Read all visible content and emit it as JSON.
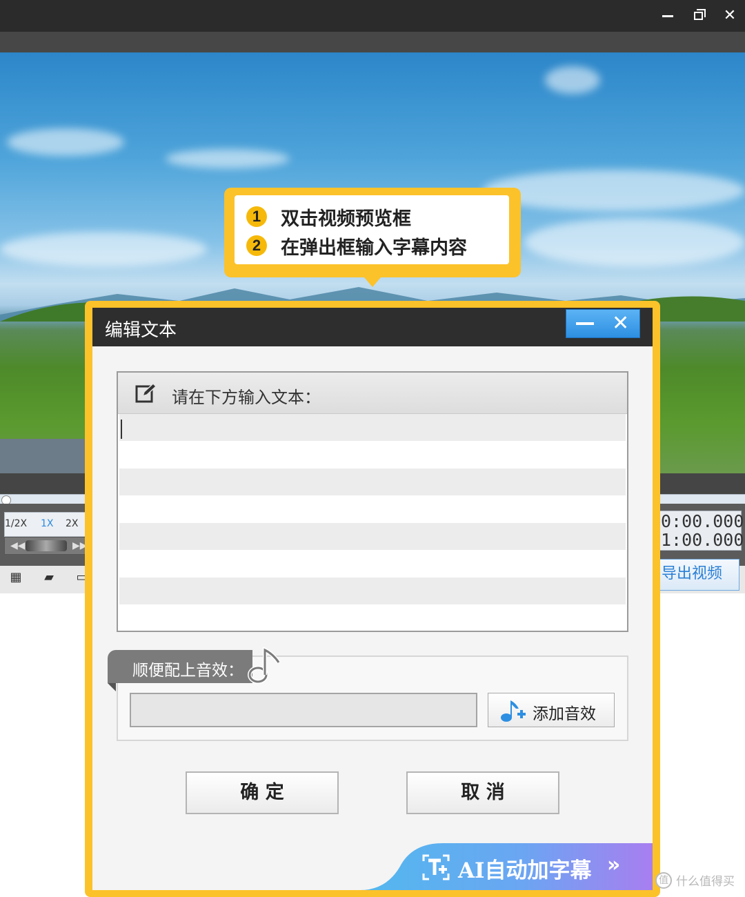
{
  "app": {
    "window_controls": {
      "minimize": "minimize",
      "restore": "restore",
      "close": "close"
    }
  },
  "player": {
    "speeds": [
      "1/2X",
      "1X",
      "2X"
    ],
    "active_speed": "1X",
    "time_current": "0:00.000",
    "time_total": "1:00.000",
    "export_label": "导出视频"
  },
  "callout": {
    "steps": [
      {
        "num": "1",
        "text": "双击视频预览框"
      },
      {
        "num": "2",
        "text": "在弹出框输入字幕内容"
      }
    ]
  },
  "dialog": {
    "title": "编辑文本",
    "input_label": "请在下方输入文本：",
    "sound_label": "顺便配上音效：",
    "add_sound_label": "添加音效",
    "ok_label": "确 定",
    "cancel_label": "取 消",
    "ai_label": "AI自动加字幕"
  },
  "watermark": {
    "badge": "值",
    "text": "什么值得买"
  },
  "colors": {
    "accent_yellow": "#fcc22a",
    "title_dark": "#2e2e2e",
    "blue": "#2d8fe2",
    "ai_gradient_start": "#52b8ee",
    "ai_gradient_end": "#a87ef0"
  }
}
